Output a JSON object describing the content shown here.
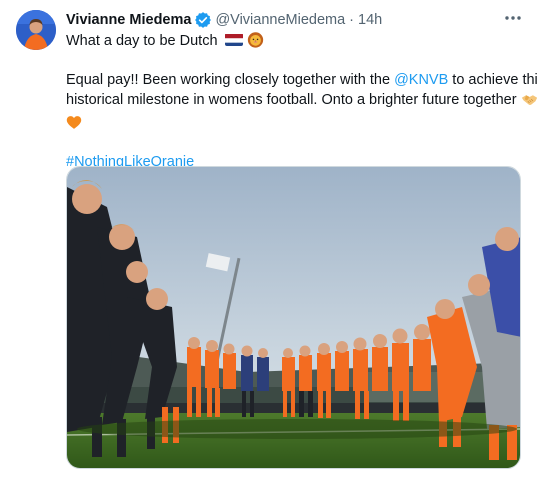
{
  "tweet": {
    "author_name": "Vivianne Miedema",
    "handle": "@VivianneMiedema",
    "separator": "·",
    "time": "14h",
    "more_icon": "more-horizontal-icon",
    "text_line1": "What a day to be Dutch",
    "text_line2_a": "Equal pay!! Been working closely together with the ",
    "mention": "@KNVB",
    "text_line2_b": " to achieve this",
    "text_line3": "historical milestone in womens football. Onto a brighter future together",
    "hashtag": "#NothingLikeOranje"
  },
  "colors": {
    "link": "#1d9bf0",
    "text": "#0f1419",
    "secondary": "#536471",
    "verified": "#1d9bf0",
    "oranje": "#f36c21"
  },
  "icons": [
    "netherlands-flag-icon",
    "lion-face-icon",
    "handshake-icon",
    "orange-heart-icon",
    "verified-badge-icon"
  ]
}
